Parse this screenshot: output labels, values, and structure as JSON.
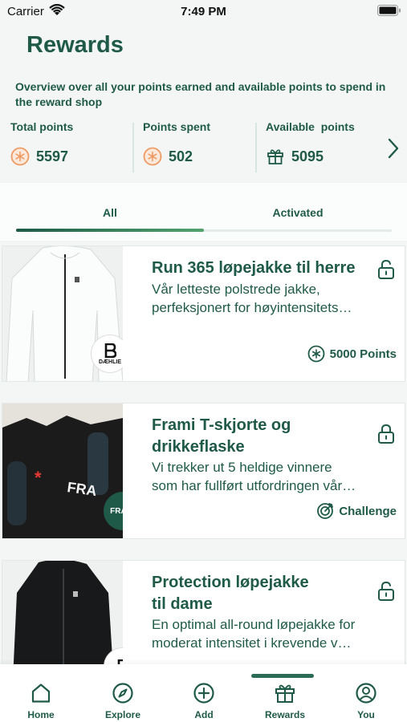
{
  "status_bar": {
    "carrier": "Carrier",
    "time": "7:49 PM"
  },
  "header": {
    "title": "Rewards",
    "subtitle": "Overview over all your points earned and available points to spend in the reward shop"
  },
  "points": {
    "total_label": "Total points",
    "total_value": "5597",
    "spent_label": "Points spent",
    "spent_value": "502",
    "available_label": "Available  points",
    "available_value": "5095"
  },
  "tabs": [
    {
      "label": "All",
      "active": true
    },
    {
      "label": "Activated",
      "active": false
    }
  ],
  "rewards": [
    {
      "title": "Run 365 løpejakke til herre",
      "description_line1": "Vår letteste polstrede jakke,",
      "description_line2": "perfeksjonert for høyintensitets…",
      "meta": "5000 Points",
      "meta_icon": "points-coin-icon",
      "brand": "DÆHLIE"
    },
    {
      "title_line1": "Frami T-skjorte og",
      "title_line2": "drikkeflaske",
      "description_line1": "Vi trekker ut 5 heldige vinnere",
      "description_line2": "som har fullført utfordringen vår…",
      "meta": "Challenge",
      "meta_icon": "target-icon",
      "brand": "FRAMI"
    },
    {
      "title_line1": "Protection løpejakke",
      "title_line2": "til dame",
      "description_line1": "En optimal all-round løpejakke for",
      "description_line2": "moderat intensitet i krevende v…"
    }
  ],
  "bottom_nav": [
    {
      "label": "Home",
      "icon": "home-icon"
    },
    {
      "label": "Explore",
      "icon": "compass-icon"
    },
    {
      "label": "Add",
      "icon": "plus-circle-icon"
    },
    {
      "label": "Rewards",
      "icon": "gift-icon",
      "active": true
    },
    {
      "label": "You",
      "icon": "user-icon"
    }
  ],
  "colors": {
    "primary": "#1f5a48",
    "accent": "#f0a26a",
    "background": "#f3f6f5"
  }
}
